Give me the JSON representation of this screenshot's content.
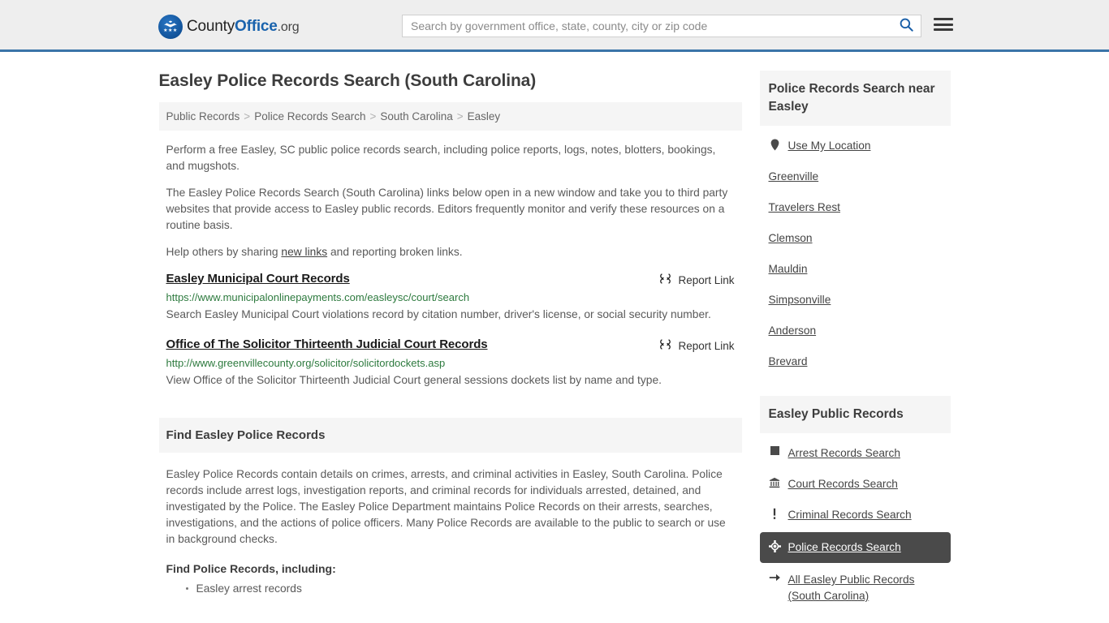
{
  "header": {
    "logo": {
      "part1": "County",
      "part2": "Office",
      "part3": ".org",
      "icon": "eagle-seal-icon"
    },
    "search": {
      "placeholder": "Search by government office, state, county, city or zip code",
      "value": "",
      "icon": "search-icon"
    },
    "menu_icon": "hamburger-menu-icon",
    "accent_color": "#3a74a8"
  },
  "main": {
    "title": "Easley Police Records Search (South Carolina)",
    "breadcrumb": {
      "separator": ">",
      "items": [
        {
          "label": "Public Records"
        },
        {
          "label": "Police Records Search"
        },
        {
          "label": "South Carolina"
        },
        {
          "label": "Easley"
        }
      ]
    },
    "intro_paragraphs": [
      "Perform a free Easley, SC public police records search, including police reports, logs, notes, blotters, bookings, and mugshots.",
      "The Easley Police Records Search (South Carolina) links below open in a new window and take you to third party websites that provide access to Easley public records. Editors frequently monitor and verify these resources on a routine basis."
    ],
    "help_line": {
      "before": "Help others by sharing ",
      "link": "new links",
      "after": " and reporting broken links."
    },
    "report_link_label": "Report Link",
    "report_link_icon": "broken-link-icon",
    "results": [
      {
        "title": "Easley Municipal Court Records",
        "url": "https://www.municipalonlinepayments.com/easleysc/court/search",
        "description": "Search Easley Municipal Court violations record by citation number, driver's license, or social security number."
      },
      {
        "title": "Office of The Solicitor Thirteenth Judicial Court Records",
        "url": "http://www.greenvillecounty.org/solicitor/solicitordockets.asp",
        "description": "View Office of the Solicitor Thirteenth Judicial Court general sessions dockets list by name and type."
      }
    ],
    "find_section": {
      "heading": "Find Easley Police Records",
      "paragraph": "Easley Police Records contain details on crimes, arrests, and criminal activities in Easley, South Carolina. Police records include arrest logs, investigation reports, and criminal records for individuals arrested, detained, and investigated by the Police. The Easley Police Department maintains Police Records on their arrests, searches, investigations, and the actions of police officers. Many Police Records are available to the public to search or use in background checks.",
      "subheading": "Find Police Records, including:",
      "items": [
        "Easley arrest records"
      ]
    }
  },
  "sidebar": {
    "near_panel": {
      "heading": "Police Records Search near Easley",
      "items": [
        {
          "label": "Use My Location",
          "icon": "map-pin-icon"
        },
        {
          "label": "Greenville",
          "icon": ""
        },
        {
          "label": "Travelers Rest",
          "icon": ""
        },
        {
          "label": "Clemson",
          "icon": ""
        },
        {
          "label": "Mauldin",
          "icon": ""
        },
        {
          "label": "Simpsonville",
          "icon": ""
        },
        {
          "label": "Anderson",
          "icon": ""
        },
        {
          "label": "Brevard",
          "icon": ""
        }
      ]
    },
    "public_records_panel": {
      "heading": "Easley Public Records",
      "active_color": "#4a4a4a",
      "items": [
        {
          "label": "Arrest Records Search",
          "icon": "square-icon",
          "active": false
        },
        {
          "label": "Court Records Search",
          "icon": "courthouse-icon",
          "active": false
        },
        {
          "label": "Criminal Records Search",
          "icon": "exclamation-icon",
          "active": false
        },
        {
          "label": "Police Records Search",
          "icon": "police-badge-icon",
          "active": true
        },
        {
          "label": "All Easley Public Records (South Carolina)",
          "icon": "arrow-right-icon",
          "active": false
        }
      ]
    }
  }
}
